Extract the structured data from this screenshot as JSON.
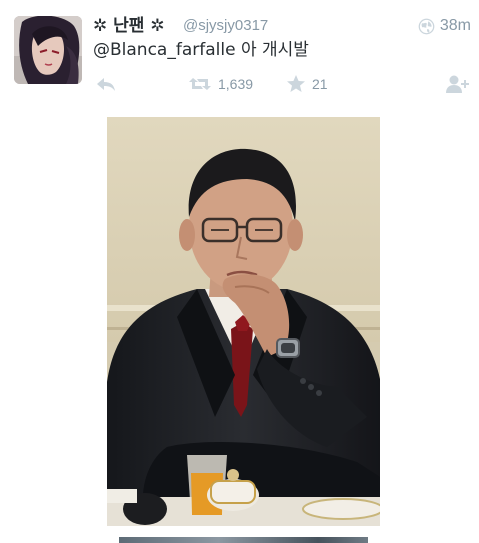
{
  "tweet": {
    "display_name": "✲ 난팬 ✲",
    "username": "@sjysjy0317",
    "timestamp": "38m",
    "text_mention": "@Blanca_farfalle",
    "text_body": " 아 개시발",
    "actions": {
      "reply_icon": "reply-icon",
      "retweet_icon": "retweet-icon",
      "retweet_count": "1,639",
      "favorite_icon": "star-icon",
      "favorite_count": "21",
      "follow_icon": "follow-user-icon"
    },
    "icons": {
      "visibility": "globe-icon"
    }
  },
  "colors": {
    "text": "#292f33",
    "muted": "#8899a6",
    "icon": "#ccd6dd"
  }
}
